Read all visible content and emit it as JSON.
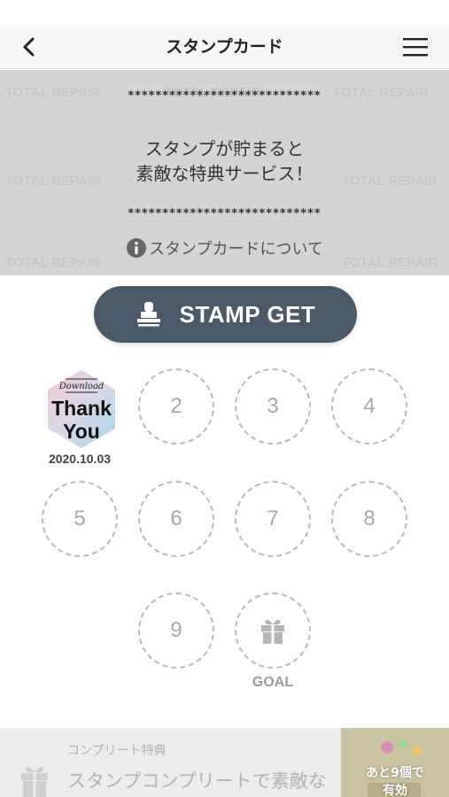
{
  "header": {
    "title": "スタンプカード"
  },
  "hero": {
    "stars_top": "****************************",
    "line1": "スタンプが貯まると",
    "line2": "素敵な特典サービス！",
    "stars_bottom": "****************************",
    "about_link": "スタンプカードについて",
    "watermark_text": "TOTAL REPAIR"
  },
  "stamp_get": {
    "label": "STAMP GET"
  },
  "stamps": {
    "first": {
      "badge_top": "Download",
      "badge_line1": "Thank",
      "badge_line2": "You",
      "date": "2020.10.03"
    },
    "slots": [
      "2",
      "3",
      "4",
      "5",
      "6",
      "7",
      "8",
      "9"
    ],
    "goal_label": "GOAL"
  },
  "complete": {
    "title": "コンプリート特典",
    "description": "スタンプコンプリートで素敵な"
  },
  "thumbnail": {
    "line1": "あと9個で",
    "line2": "有効"
  },
  "colors": {
    "button": "#4a5a68",
    "hero_bg": "#d4d4d4",
    "slot_border": "#b9b9b9"
  }
}
